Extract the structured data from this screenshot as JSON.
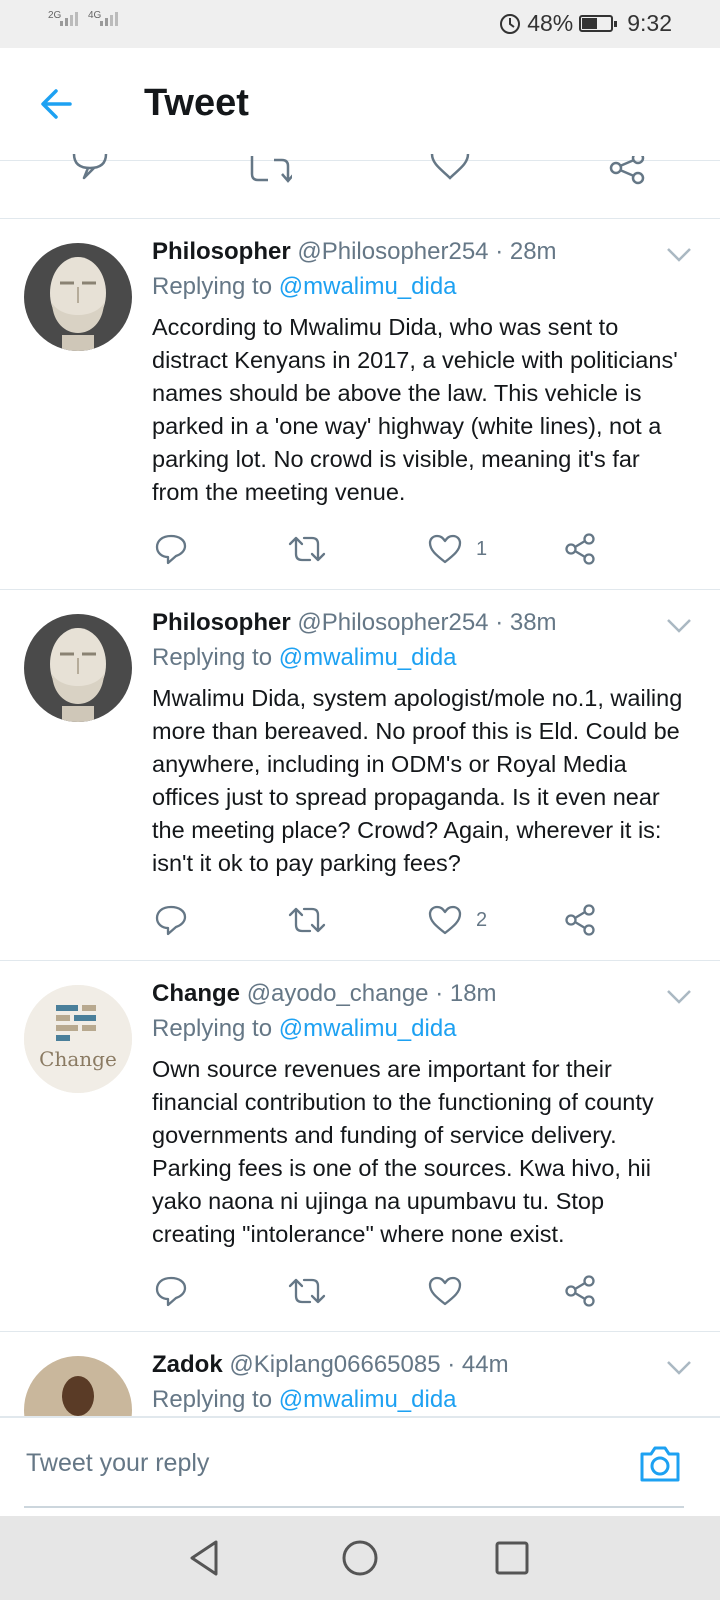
{
  "status_bar": {
    "signal1_label": "2G",
    "signal2_label": "4G",
    "battery": "48%",
    "time": "9:32"
  },
  "header": {
    "title": "Tweet"
  },
  "tweets": [
    {
      "name": "Philosopher",
      "handle": "@Philosopher254",
      "time": "· 28m",
      "replying_prefix": "Replying to",
      "replying_to": "@mwalimu_dida",
      "text": "According to Mwalimu Dida, who was sent to distract Kenyans in 2017, a vehicle with politicians' names should be above the law. This vehicle is parked in a 'one way' highway (white lines), not a parking lot. No crowd is visible, meaning it's far from the meeting venue.",
      "likes": "1"
    },
    {
      "name": "Philosopher",
      "handle": "@Philosopher254",
      "time": "· 38m",
      "replying_prefix": "Replying to",
      "replying_to": "@mwalimu_dida",
      "text": "Mwalimu Dida, system apologist/mole no.1, wailing more than bereaved. No proof this is Eld. Could be anywhere, including in ODM's or Royal Media offices just to spread propaganda. Is it even near the meeting place? Crowd? Again, wherever it is: isn't it ok to pay parking fees?",
      "likes": "2"
    },
    {
      "name": "Change",
      "handle": "@ayodo_change",
      "time": "· 18m",
      "replying_prefix": "Replying to",
      "replying_to": "@mwalimu_dida",
      "text": "Own source revenues are important for their financial contribution to the functioning of county governments and funding of service delivery. Parking fees is one of the sources. Kwa hivo, hii yako naona ni ujinga na upumbavu tu. Stop creating \"intolerance\" where none exist.",
      "likes": "",
      "avatar_text": "Change"
    },
    {
      "name": "Zadok",
      "handle": "@Kiplang06665085",
      "time": "· 44m",
      "replying_prefix": "Replying to",
      "replying_to": "@mwalimu_dida"
    }
  ],
  "reply_bar": {
    "placeholder": "Tweet your reply"
  },
  "colors": {
    "accent": "#1da1f2",
    "secondary_text": "#657786",
    "primary_text": "#14171a",
    "divider": "#e1e8ed"
  },
  "icons": [
    "back-arrow-icon",
    "reply-icon",
    "retweet-icon",
    "like-icon",
    "share-icon",
    "chevron-down-icon",
    "camera-icon",
    "nav-back-icon",
    "nav-home-icon",
    "nav-recents-icon"
  ]
}
